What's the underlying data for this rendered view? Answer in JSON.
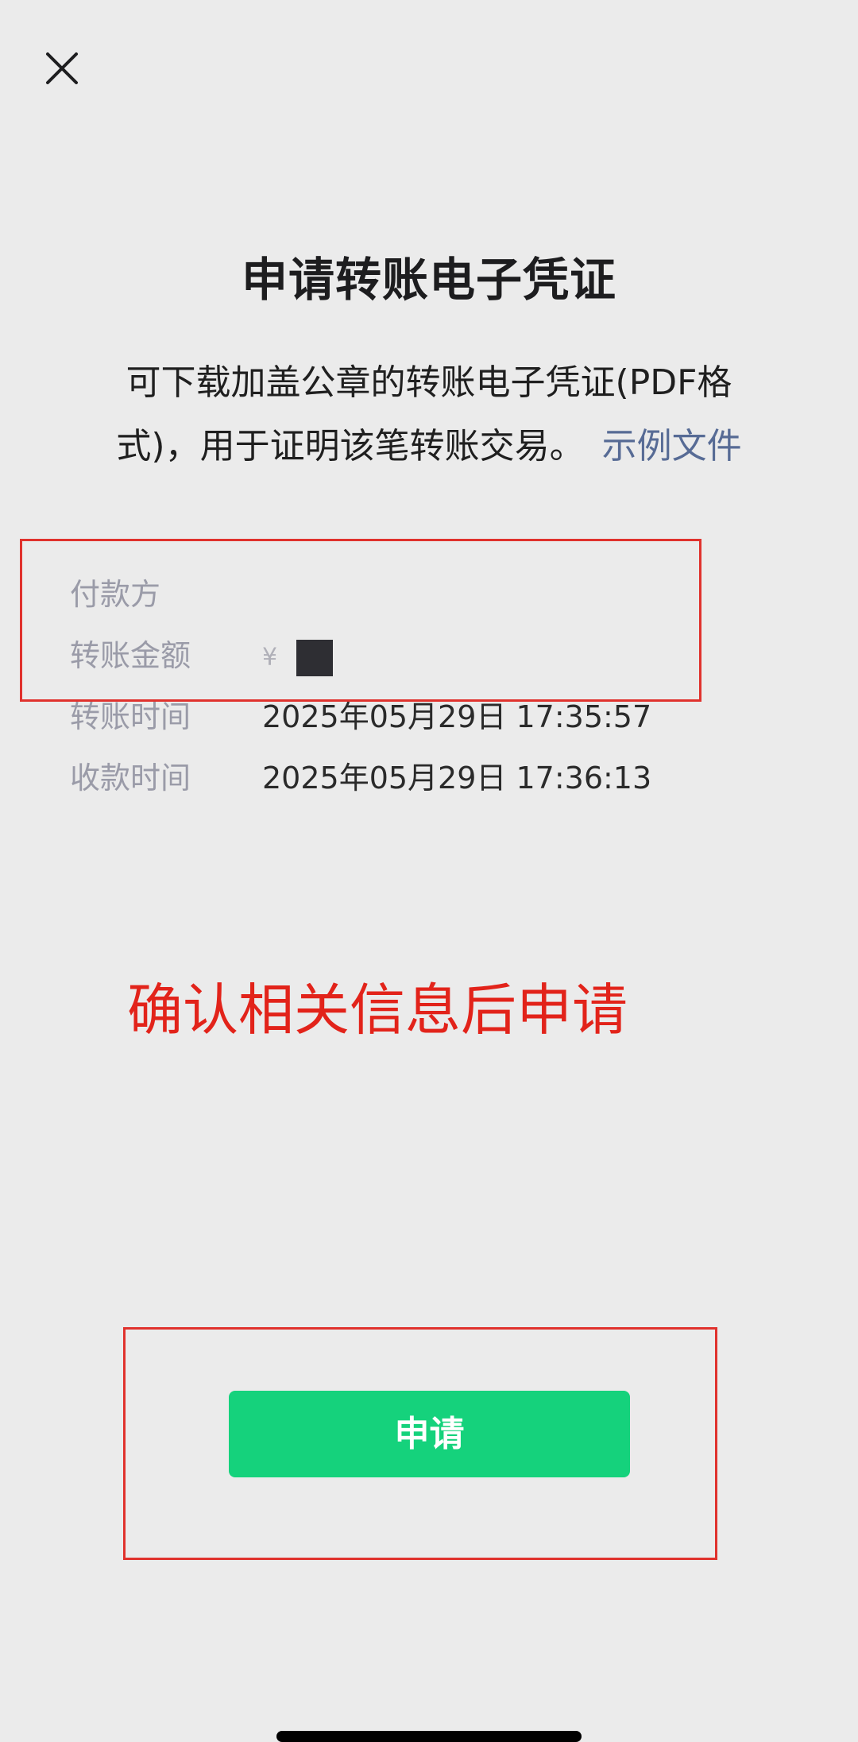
{
  "header": {
    "close_icon": "close-icon",
    "title": "申请转账电子凭证"
  },
  "description": {
    "text": "可下载加盖公章的转账电子凭证(PDF格式)，用于证明该笔转账交易。",
    "link": "示例文件"
  },
  "details": {
    "payer_label": "付款方",
    "payer_value": "",
    "amount_label": "转账金额",
    "amount_prefix": "¥",
    "transfer_time_label": "转账时间",
    "transfer_time_value": "2025年05月29日 17:35:57",
    "receive_time_label": "收款时间",
    "receive_time_value": "2025年05月29日 17:36:13"
  },
  "annotation": {
    "text": "确认相关信息后申请",
    "color": "#e2231a"
  },
  "actions": {
    "apply_label": "申请",
    "apply_color": "#15d27c"
  }
}
